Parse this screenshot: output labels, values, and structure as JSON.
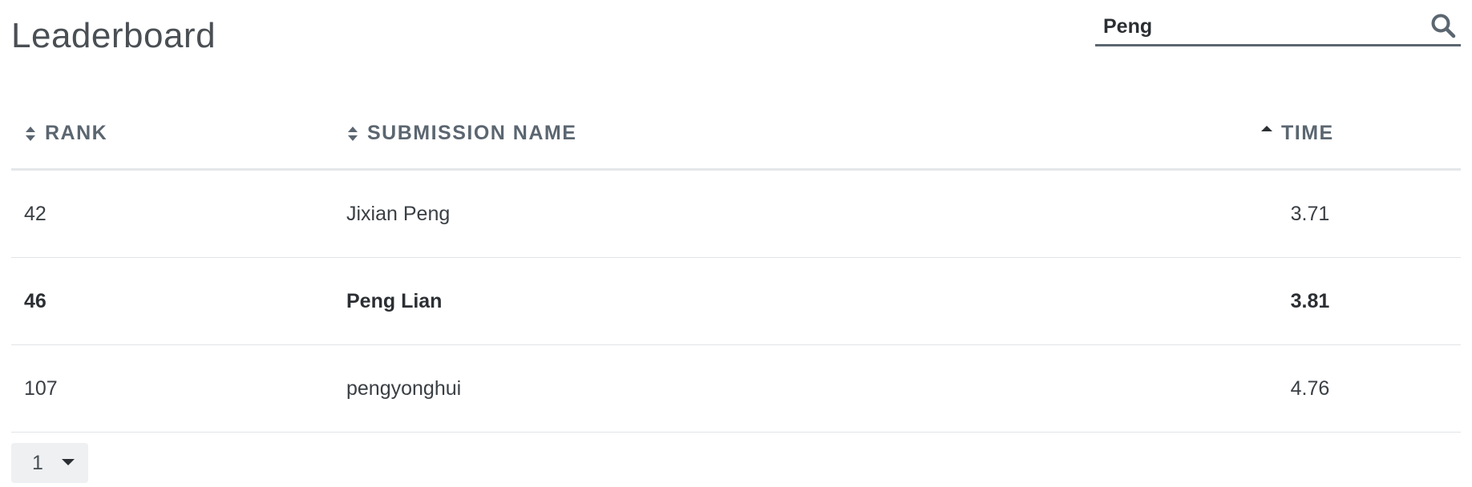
{
  "header": {
    "title": "Leaderboard"
  },
  "search": {
    "value": "Peng",
    "icon": "search-icon"
  },
  "table": {
    "columns": [
      {
        "label": "RANK",
        "sort": "unsorted"
      },
      {
        "label": "SUBMISSION NAME",
        "sort": "unsorted"
      },
      {
        "label": "TIME",
        "sort": "ascending"
      }
    ],
    "rows": [
      {
        "rank": "42",
        "name": "Jixian Peng",
        "time": "3.71",
        "highlighted": false
      },
      {
        "rank": "46",
        "name": "Peng Lian",
        "time": "3.81",
        "highlighted": true
      },
      {
        "rank": "107",
        "name": "pengyonghui",
        "time": "4.76",
        "highlighted": false
      }
    ]
  },
  "pagination": {
    "selected_page": "1"
  },
  "colors": {
    "text": "#2b2f33",
    "header_text": "#5b6670",
    "divider": "#e1e4e7",
    "pager_bg": "#eef0f2"
  }
}
